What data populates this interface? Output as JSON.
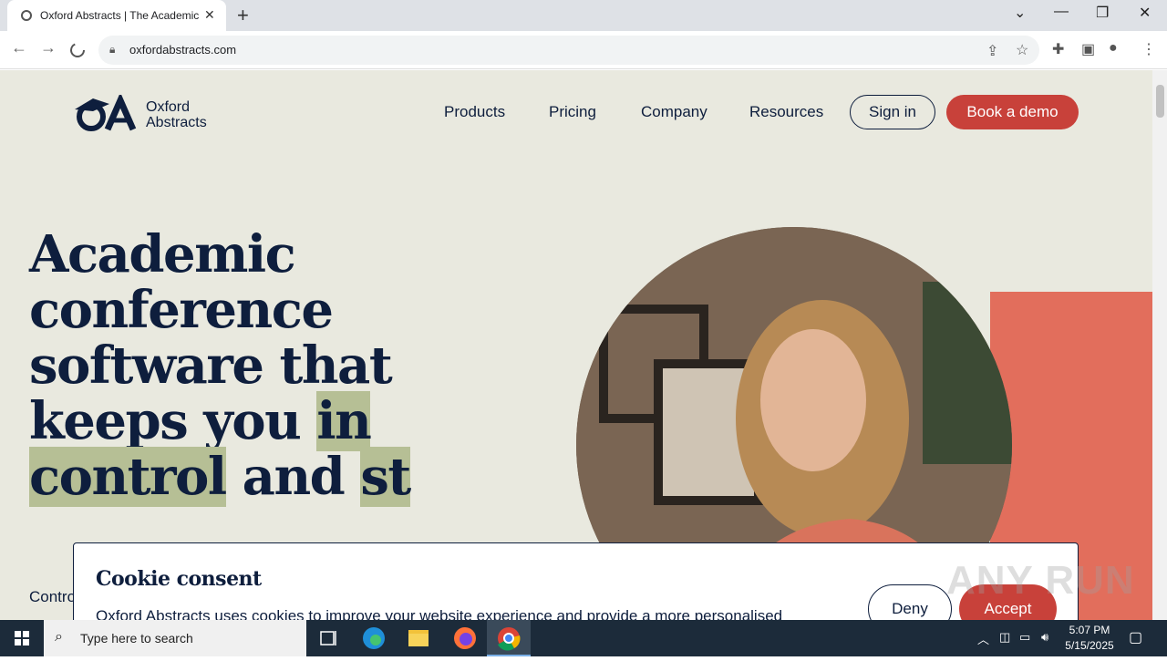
{
  "browser": {
    "tab_title": "Oxford Abstracts | The Academic",
    "tab_close": "✕",
    "new_tab": "+",
    "url": "oxfordabstracts.com",
    "window_controls": [
      "⌄",
      "—",
      "❐",
      "✕"
    ]
  },
  "site": {
    "logo": {
      "line1": "Oxford",
      "line2": "Abstracts"
    },
    "nav": [
      "Products",
      "Pricing",
      "Company",
      "Resources"
    ],
    "signin_label": "Sign in",
    "demo_label": "Book a demo",
    "hero": {
      "part1": "Academic conference software that keeps you ",
      "highlight1": "in control",
      "part2": " and ",
      "highlight2": "st"
    },
    "subtext": "Contro",
    "colors": {
      "navy": "#0e1e3d",
      "accent": "#c8413a",
      "highlight": "#b6bf95",
      "coral": "#e26e5c",
      "background": "#e9e9df"
    }
  },
  "cookie": {
    "title": "Cookie consent",
    "body": "Oxford Abstracts uses cookies to improve your website experience and provide a more personalised experience both on this website, and through other media. Learn more here.",
    "deny_label": "Deny",
    "accept_label": "Accept"
  },
  "watermark": "ANY RUN",
  "taskbar": {
    "search_placeholder": "Type here to search",
    "time": "5:07 PM",
    "date": "5/15/2025"
  }
}
